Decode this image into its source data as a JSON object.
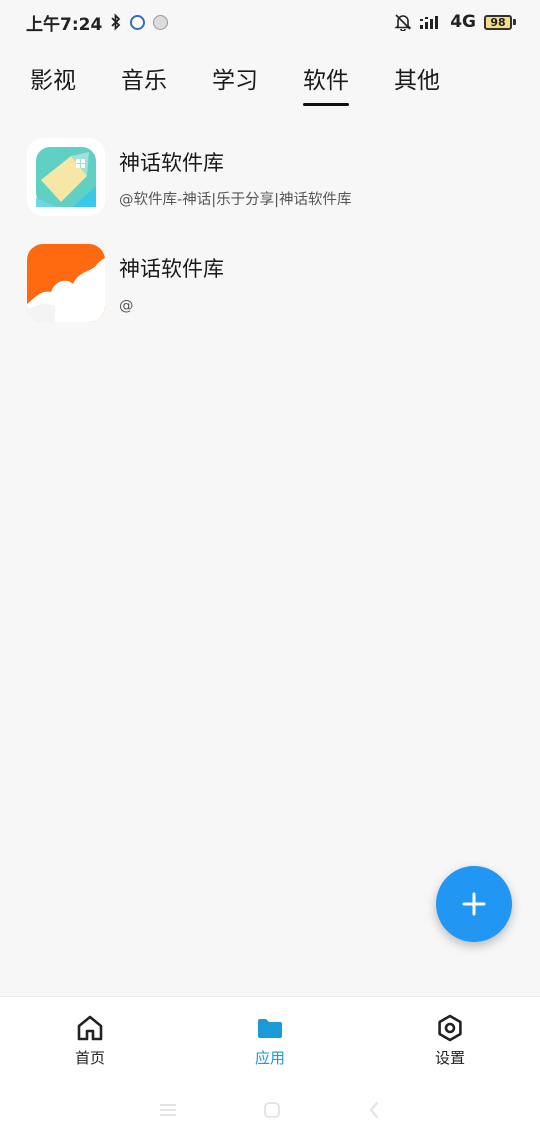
{
  "status_bar": {
    "time": "上午7:24",
    "network": "4G",
    "battery": "98"
  },
  "tabs": [
    {
      "label": "影视"
    },
    {
      "label": "音乐"
    },
    {
      "label": "学习"
    },
    {
      "label": "软件",
      "active": true
    },
    {
      "label": "其他"
    }
  ],
  "apps": [
    {
      "name": "神话软件库",
      "desc": "@软件库-神话|乐于分享|神话软件库"
    },
    {
      "name": "神话软件库",
      "desc": "@"
    }
  ],
  "bottom_nav": [
    {
      "label": "首页",
      "icon": "home-icon"
    },
    {
      "label": "应用",
      "icon": "folder-icon",
      "active": true
    },
    {
      "label": "设置",
      "icon": "settings-icon"
    }
  ],
  "colors": {
    "accent": "#2196f3",
    "active_nav": "#1a9ad6"
  }
}
